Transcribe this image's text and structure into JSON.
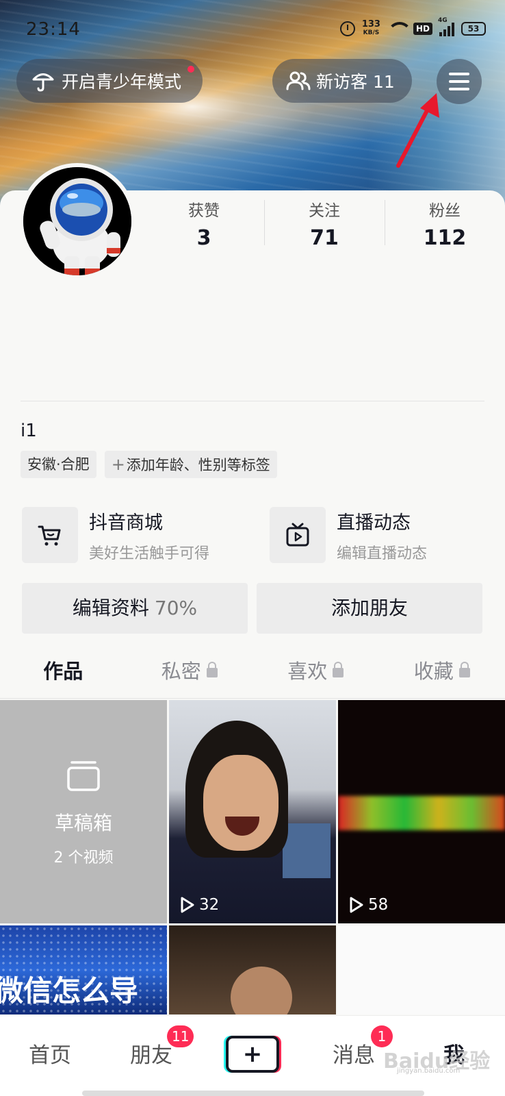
{
  "status_bar": {
    "time": "23:14",
    "speed_value": "133",
    "speed_unit": "KB/S",
    "hd": "HD",
    "network": "4G",
    "battery": "53"
  },
  "header": {
    "teen_mode_label": "开启青少年模式",
    "visitors_label": "新访客 11"
  },
  "stats": [
    {
      "label": "获赞",
      "value": "3"
    },
    {
      "label": "关注",
      "value": "71"
    },
    {
      "label": "粉丝",
      "value": "112"
    }
  ],
  "profile": {
    "username": "i1",
    "location_tag": "安徽·合肥",
    "add_tag_label": "添加年龄、性别等标签"
  },
  "features": {
    "mall": {
      "title": "抖音商城",
      "subtitle": "美好生活触手可得"
    },
    "live": {
      "title": "直播动态",
      "subtitle": "编辑直播动态"
    }
  },
  "actions": {
    "edit_label": "编辑资料",
    "edit_percent": "70%",
    "add_friend_label": "添加朋友"
  },
  "tabs": [
    {
      "label": "作品"
    },
    {
      "label": "私密"
    },
    {
      "label": "喜欢"
    },
    {
      "label": "收藏"
    }
  ],
  "grid": {
    "draft_title": "草稿箱",
    "draft_count": "2 个视频",
    "video1_plays": "32",
    "video2_plays": "58",
    "video3_text": "微信怎么导"
  },
  "bottom_nav": {
    "home": "首页",
    "friends": "朋友",
    "friends_badge": "11",
    "plus": "+",
    "messages": "消息",
    "messages_badge": "1",
    "me": "我"
  },
  "watermark": {
    "text": "Baidu经验",
    "sub": "jingyan.baidu.com"
  },
  "colors": {
    "accent": "#fe2c55",
    "arrow": "#e8182c"
  }
}
